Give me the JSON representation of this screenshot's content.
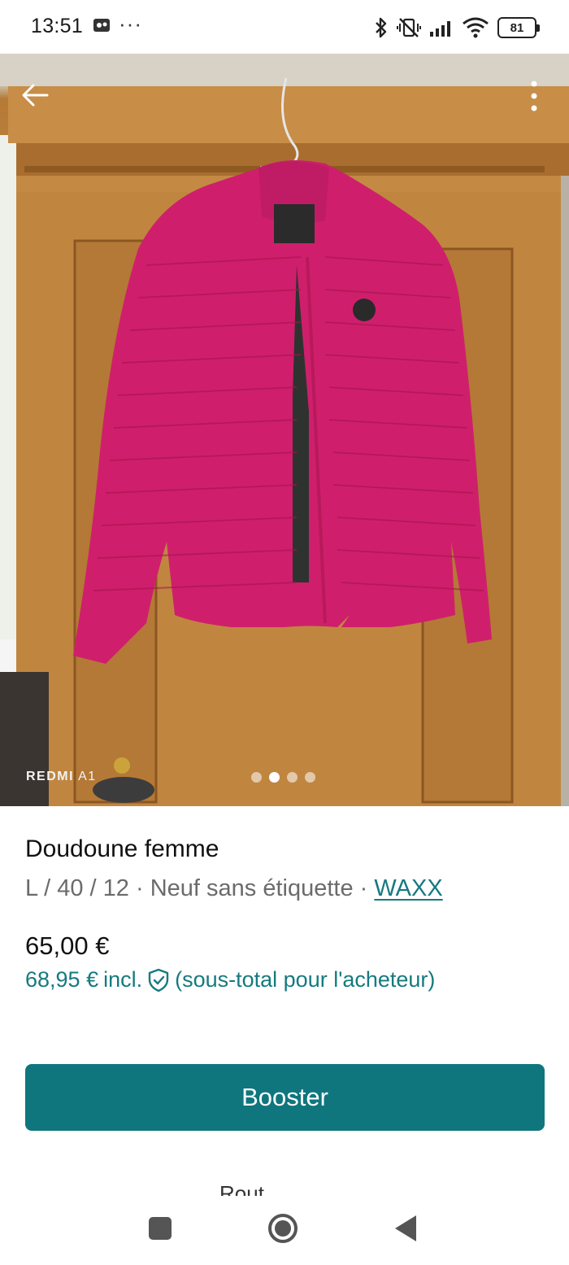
{
  "status_bar": {
    "time": "13:51",
    "more": "···",
    "battery": "81",
    "icons": [
      "app-notification-icon",
      "bluetooth-icon",
      "vibrate-off-icon",
      "signal-icon",
      "wifi-icon",
      "battery-icon"
    ]
  },
  "photo": {
    "watermark_brand": "REDMI",
    "watermark_model": "A1",
    "pager": {
      "count": 4,
      "active_index": 1
    }
  },
  "item": {
    "title": "Doudoune femme",
    "size": "L / 40 / 12",
    "separator": " · ",
    "condition": "Neuf sans étiquette",
    "brand": "WAXX",
    "price": "65,00 €",
    "price_incl": "68,95 €",
    "incl_label": "incl.",
    "subtotal_note": "(sous-total pour l'acheteur)"
  },
  "actions": {
    "booster_label": "Booster",
    "partial_next": "Rout..."
  },
  "colors": {
    "accent": "#0f767e",
    "link": "#157a80",
    "jacket": "#d0216f"
  }
}
